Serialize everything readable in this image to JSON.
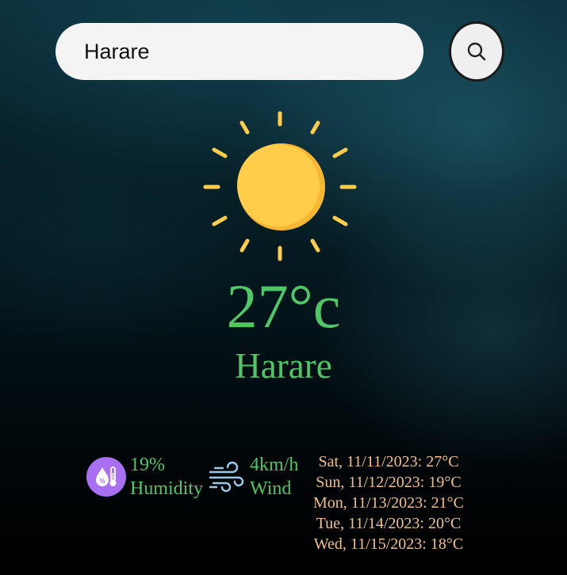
{
  "search": {
    "value": "Harare",
    "icon": "search-icon"
  },
  "current": {
    "icon": "sun-icon",
    "temperature": "27°c",
    "city": "Harare"
  },
  "humidity": {
    "icon": "humidity-icon",
    "value": "19%",
    "label": "Humidity"
  },
  "wind": {
    "icon": "wind-icon",
    "value": "4km/h",
    "label": "Wind"
  },
  "forecast": [
    "Sat, 11/11/2023: 27°C",
    "Sun, 11/12/2023: 19°C",
    "Mon, 11/13/2023: 21°C",
    "Tue, 11/14/2023: 20°C",
    "Wed, 11/15/2023: 18°C"
  ],
  "colors": {
    "accent_text": "#4fc767",
    "forecast_text": "#f0c08e",
    "sun": "#ffcd4a",
    "humidity_badge": "#a96ff2"
  }
}
